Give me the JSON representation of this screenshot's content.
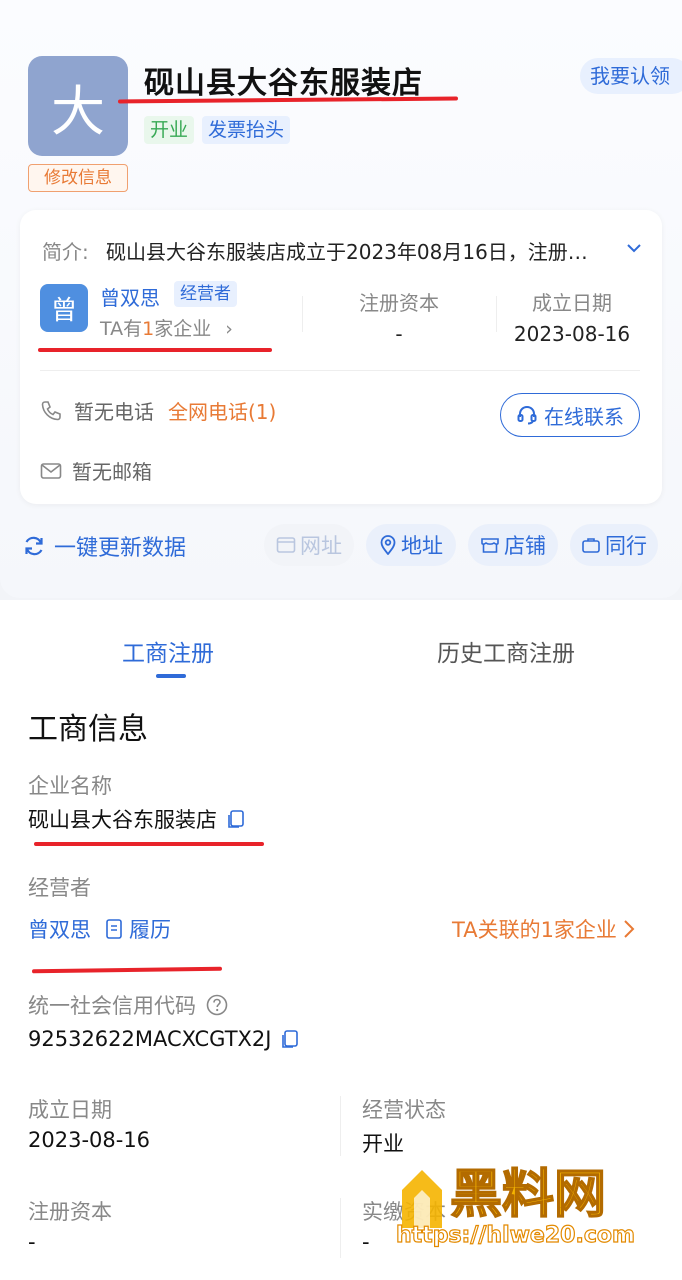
{
  "header": {
    "logo_char": "大",
    "company_name": "砚山县大谷东服装店",
    "claim_label": "我要认领",
    "tags": [
      "开业",
      "发票抬头"
    ],
    "edit_label": "修改信息"
  },
  "summary": {
    "intro_label": "简介:",
    "intro_text": "砚山县大谷东服装店成立于2023年08月16日，注册…",
    "owner": {
      "avatar_char": "曾",
      "name": "曾双思",
      "role": "经营者",
      "count_prefix": "TA有",
      "count_num": "1",
      "count_suffix": "家企业"
    },
    "registered_capital_label": "注册资本",
    "registered_capital_value": "-",
    "founded_label": "成立日期",
    "founded_value": "2023-08-16",
    "phone_text": "暂无电话",
    "all_phone_text": "全网电话(1)",
    "contact_button": "在线联系",
    "email_text": "暂无邮箱"
  },
  "actions": {
    "refresh_label": "一键更新数据",
    "website": "网址",
    "address": "地址",
    "store": "店铺",
    "peers": "同行"
  },
  "tabs": [
    "工商注册",
    "历史工商注册"
  ],
  "business": {
    "title": "工商信息",
    "name_label": "企业名称",
    "name_value": "砚山县大谷东服装店",
    "operator_label": "经营者",
    "operator_value": "曾双思",
    "resume_label": "履历",
    "related_label": "TA关联的1家企业",
    "credit_code_label": "统一社会信用代码",
    "credit_code_value": "92532622MACXCGTX2J",
    "founded_label": "成立日期",
    "founded_value": "2023-08-16",
    "status_label": "经营状态",
    "status_value": "开业",
    "capital_label": "注册资本",
    "capital_value": "-",
    "paid_label": "实缴资本",
    "paid_value": "-"
  },
  "watermark": {
    "name": "黑料网",
    "url": "https://hlwe20.com"
  },
  "colors": {
    "brand_blue": "#2f6bd8",
    "accent_orange": "#e87a35",
    "status_green": "#38a955",
    "annotation_red": "#e8232a"
  }
}
